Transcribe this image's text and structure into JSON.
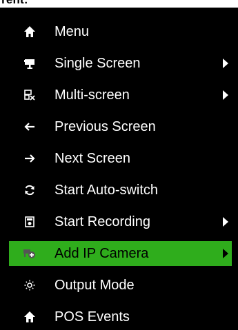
{
  "header": {
    "text": "rent:"
  },
  "menu": {
    "items": [
      {
        "label": "Menu",
        "icon": "home-icon",
        "submenu": false
      },
      {
        "label": "Single Screen",
        "icon": "monitor-icon",
        "submenu": true
      },
      {
        "label": "Multi-screen",
        "icon": "multi-screen-icon",
        "submenu": true
      },
      {
        "label": "Previous Screen",
        "icon": "arrow-left-icon",
        "submenu": false
      },
      {
        "label": "Next Screen",
        "icon": "arrow-right-icon",
        "submenu": false
      },
      {
        "label": "Start Auto-switch",
        "icon": "refresh-icon",
        "submenu": false
      },
      {
        "label": "Start Recording",
        "icon": "record-icon",
        "submenu": true
      },
      {
        "label": "Add IP Camera",
        "icon": "camera-add-icon",
        "submenu": true,
        "selected": true
      },
      {
        "label": "Output Mode",
        "icon": "sun-icon",
        "submenu": false
      },
      {
        "label": "POS Events",
        "icon": "home-icon",
        "submenu": false
      }
    ]
  },
  "colors": {
    "panel_background": "#000000",
    "text": "#ffffff",
    "selected_background": "#2fad1c",
    "selected_text": "#000000"
  }
}
